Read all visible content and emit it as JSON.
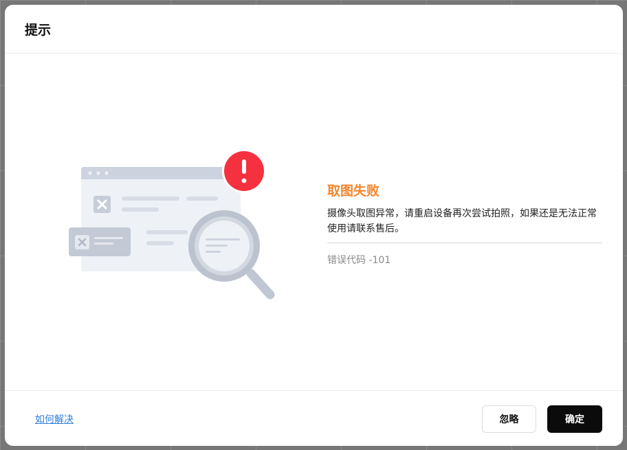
{
  "dialog": {
    "title": "提示"
  },
  "error": {
    "title": "取图失败",
    "description": "摄像头取图异常，请重启设备再次尝试拍照，如果还是无法正常使用请联系售后。",
    "code_label": "错误代码 -101"
  },
  "footer": {
    "help_link": "如何解决",
    "ignore_label": "忽略",
    "confirm_label": "确定"
  },
  "colors": {
    "accent_error_title": "#f5842a",
    "alert_badge": "#f5303f",
    "link": "#2f7de1",
    "primary_button": "#0b0b0b"
  },
  "icons": [
    "browser-window-illustration",
    "close-x-icon",
    "magnifier-icon",
    "alert-exclamation-icon"
  ]
}
